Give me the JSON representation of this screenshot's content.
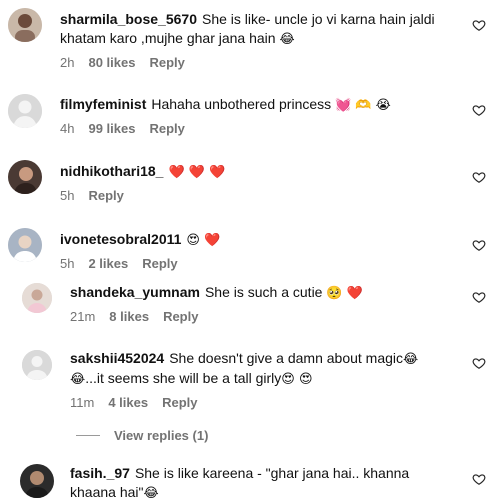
{
  "comments": [
    {
      "username": "sharmila_bose_5670",
      "text": "She is like- uncle jo vi karna hain jaldi khatam karo ,mujhe ghar jana hain",
      "emoji": "😂",
      "time": "2h",
      "likes": "80 likes",
      "reply": "Reply"
    },
    {
      "username": "filmyfeminist",
      "text": "Hahaha unbothered princess",
      "emoji": "💓 🫶 😭",
      "time": "4h",
      "likes": "99 likes",
      "reply": "Reply"
    },
    {
      "username": "nidhikothari18_",
      "text": "",
      "emoji": "❤️ ❤️ ❤️",
      "time": "5h",
      "likes": "",
      "reply": "Reply"
    },
    {
      "username": "ivonetesobral2011",
      "text": "",
      "emoji": "😍 ❤️",
      "time": "5h",
      "likes": "2 likes",
      "reply": "Reply"
    },
    {
      "username": "shandeka_yumnam",
      "text": "She is such a cutie",
      "emoji": "🥺 ❤️",
      "time": "21m",
      "likes": "8 likes",
      "reply": "Reply"
    },
    {
      "username": "sakshii452024",
      "text": "She doesn't give a damn about magic",
      "emoji": "😂 😂",
      "text2": "...it seems she will be a tall girly",
      "emoji2": "😍 😍",
      "time": "11m",
      "likes": "4 likes",
      "reply": "Reply"
    },
    {
      "username": "fasih._97",
      "text": "She is like kareena - \"ghar jana hai.. khanna khaana hai\"",
      "emoji": "😂"
    }
  ],
  "view_replies": "View replies (1)",
  "colors": {
    "meta": "#737373",
    "heart_outline": "#262626",
    "heart_red": "#ed1b24"
  }
}
